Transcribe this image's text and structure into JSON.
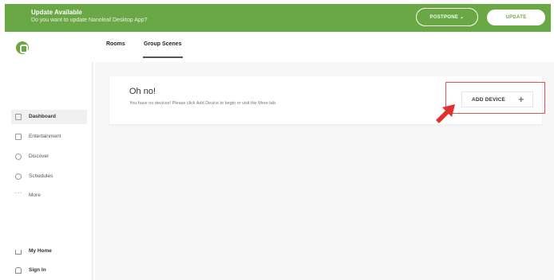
{
  "banner": {
    "title": "Update Available",
    "subtitle": "Do you want to update Nanoleaf Desktop App?",
    "postpone_label": "POSTPONE ⌄",
    "update_label": "UPDATE"
  },
  "tabs": [
    {
      "label": "Rooms"
    },
    {
      "label": "Group Scenes"
    }
  ],
  "sidebar": {
    "items": [
      {
        "label": "Dashboard",
        "icon": "dashboard-icon"
      },
      {
        "label": "Entertainment",
        "icon": "entertainment-icon"
      },
      {
        "label": "Discover",
        "icon": "discover-icon"
      },
      {
        "label": "Schedules",
        "icon": "schedules-icon"
      },
      {
        "label": "More",
        "icon": "more-icon"
      }
    ],
    "bottom": [
      {
        "label": "My Home",
        "icon": "home-icon"
      },
      {
        "label": "Sign In",
        "icon": "user-icon"
      }
    ]
  },
  "card": {
    "title": "Oh no!",
    "text": "You have no devices! Please click Add Device to begin or visit the More tab.",
    "add_device_label": "ADD DEVICE",
    "add_symbol": "+"
  },
  "colors": {
    "accent": "#6aa745",
    "highlight": "#e05555",
    "arrow": "#e03030"
  }
}
